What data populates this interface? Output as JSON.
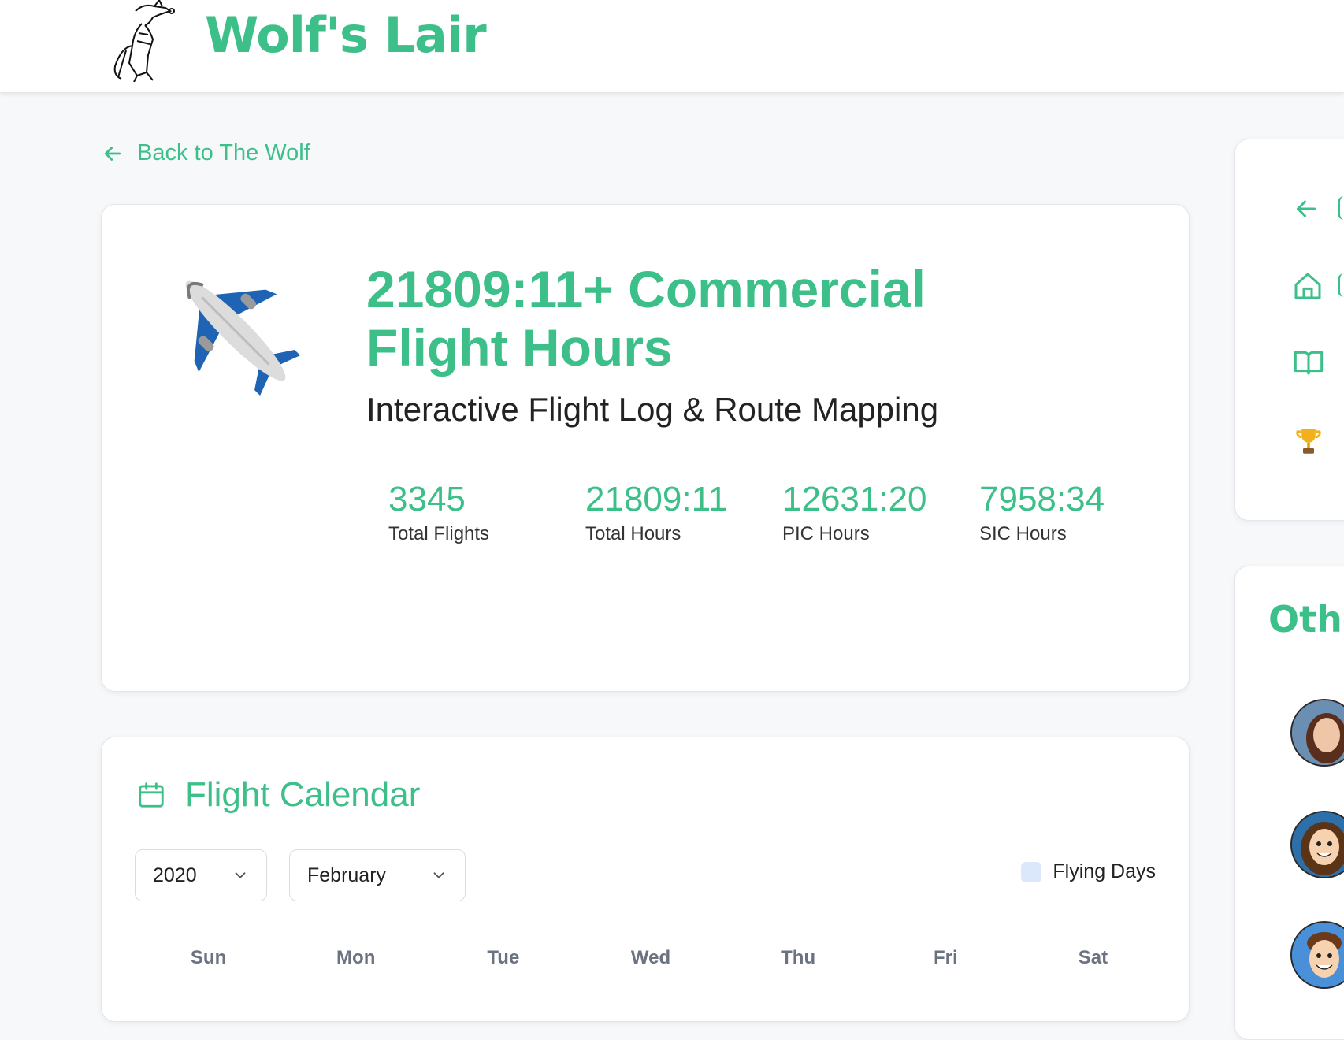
{
  "header": {
    "brand": "Wolf's Lair",
    "logo_icon": "wolf-pilot-mascot",
    "accent_color": "#3dbf8a"
  },
  "back_link": {
    "label": "Back to The Wolf",
    "icon": "arrow-left-icon"
  },
  "hero": {
    "icon": "airplane-icon",
    "title": "21809:11+ Commercial Flight Hours",
    "subtitle": "Interactive Flight Log & Route Mapping",
    "stats": [
      {
        "value": "3345",
        "label": "Total Flights"
      },
      {
        "value": "21809:11",
        "label": "Total Hours"
      },
      {
        "value": "12631:20",
        "label": "PIC Hours"
      },
      {
        "value": "7958:34",
        "label": "SIC Hours"
      }
    ]
  },
  "calendar": {
    "title": "Flight Calendar",
    "icon": "calendar-icon",
    "year": "2020",
    "month": "February",
    "legend_label": "Flying Days",
    "legend_color": "#dbe8fb",
    "weekdays": [
      "Sun",
      "Mon",
      "Tue",
      "Wed",
      "Thu",
      "Fri",
      "Sat"
    ]
  },
  "sidebar": {
    "nav_icons": [
      "arrow-left-icon",
      "home-icon",
      "book-icon",
      "trophy-icon"
    ],
    "section_title": "Othe",
    "avatars": [
      "avatar-1",
      "avatar-2",
      "avatar-3"
    ]
  }
}
